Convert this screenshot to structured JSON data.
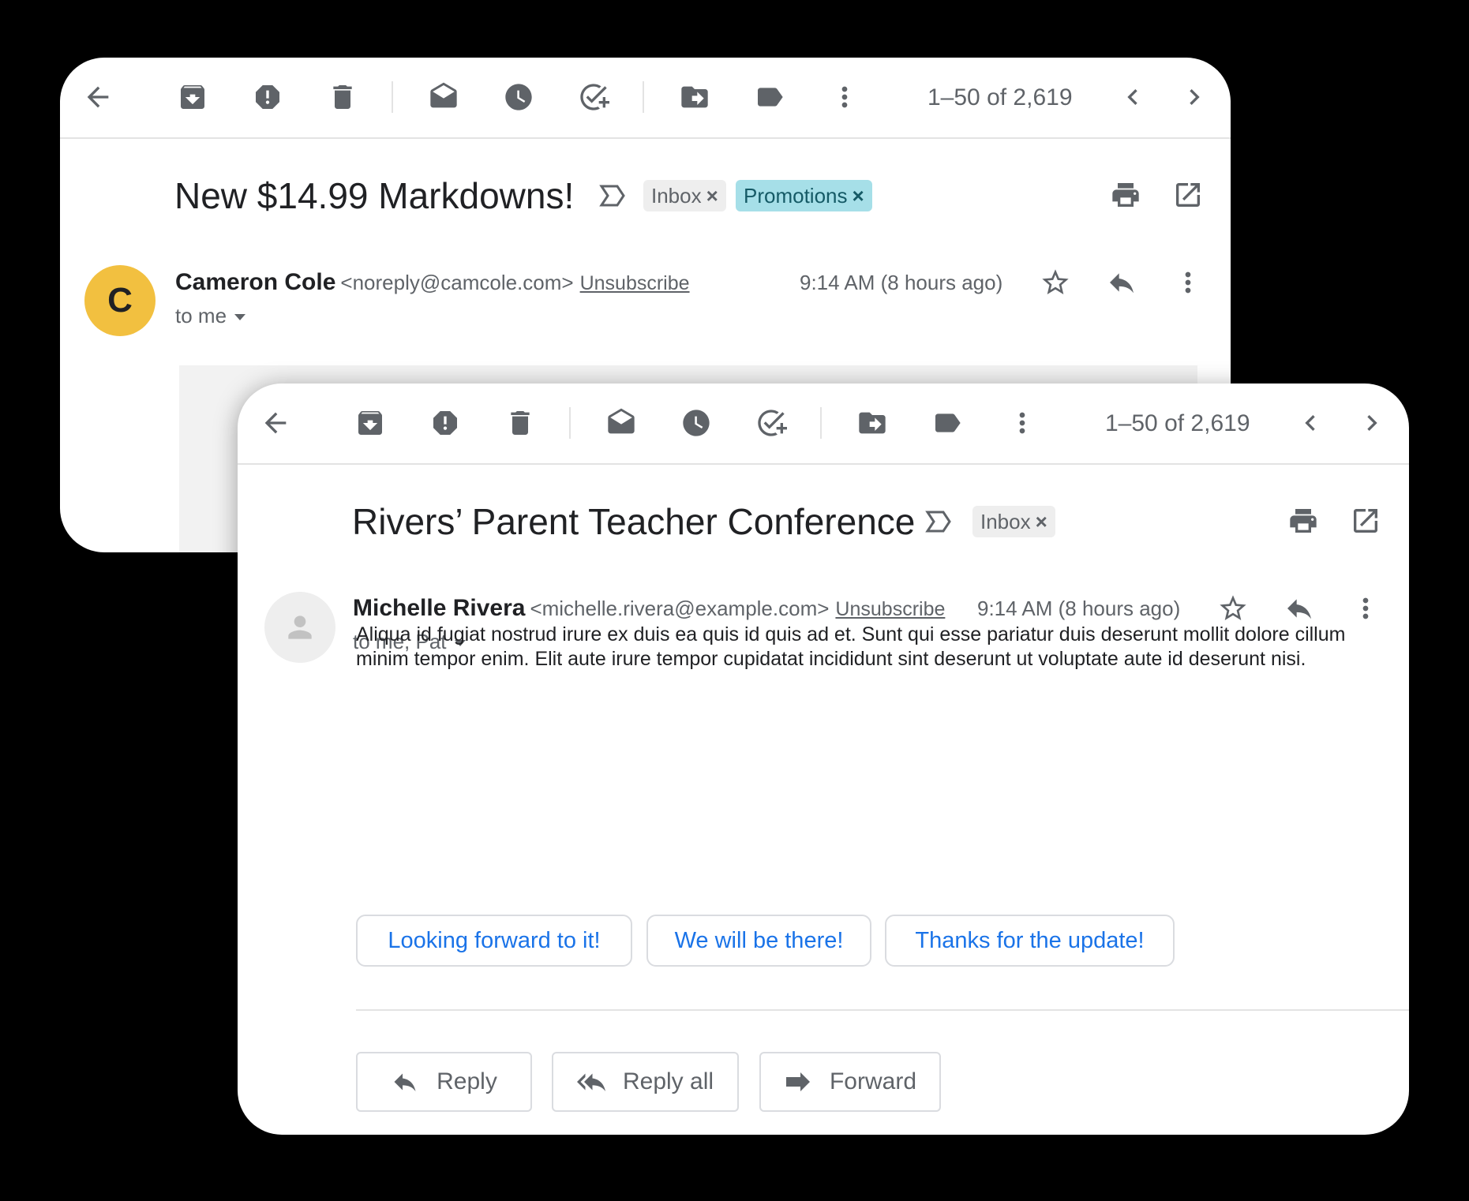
{
  "back_email": {
    "toolbar": {
      "count": "1–50 of 2,619"
    },
    "subject": "New $14.99 Markdowns!",
    "labels": [
      {
        "text": "Inbox",
        "x": "×"
      },
      {
        "text": "Promotions",
        "x": "×"
      }
    ],
    "avatar_letter": "C",
    "sender_name": "Cameron Cole",
    "sender_email": "<noreply@camcole.com>",
    "unsubscribe": "Unsubscribe",
    "to": "to me",
    "time": "9:14 AM (8 hours ago)"
  },
  "front_email": {
    "toolbar": {
      "count": "1–50 of 2,619"
    },
    "subject": "Rivers’ Parent Teacher Conference",
    "labels": [
      {
        "text": "Inbox",
        "x": "×"
      }
    ],
    "sender_name": "Michelle Rivera",
    "sender_email": "<michelle.rivera@example.com>",
    "unsubscribe": "Unsubscribe",
    "to": "to me, Pat",
    "time": "9:14 AM (8 hours ago)",
    "body": "Aliqua id fugiat nostrud irure ex duis ea quis id quis ad et. Sunt qui esse pariatur duis deserunt mollit dolore cillum minim tempor enim. Elit aute irure tempor cupidatat incididunt sint deserunt ut voluptate aute id deserunt nisi.",
    "smart_replies": [
      "Looking forward to it!",
      "We will be there!",
      "Thanks for the update!"
    ],
    "actions": {
      "reply": "Reply",
      "reply_all": "Reply all",
      "forward": "Forward"
    }
  },
  "colors": {
    "accent": "#1a73e8",
    "promo_chip": "#a6dfe8",
    "avatar_c": "#f2c040",
    "icon": "#5f6368"
  }
}
